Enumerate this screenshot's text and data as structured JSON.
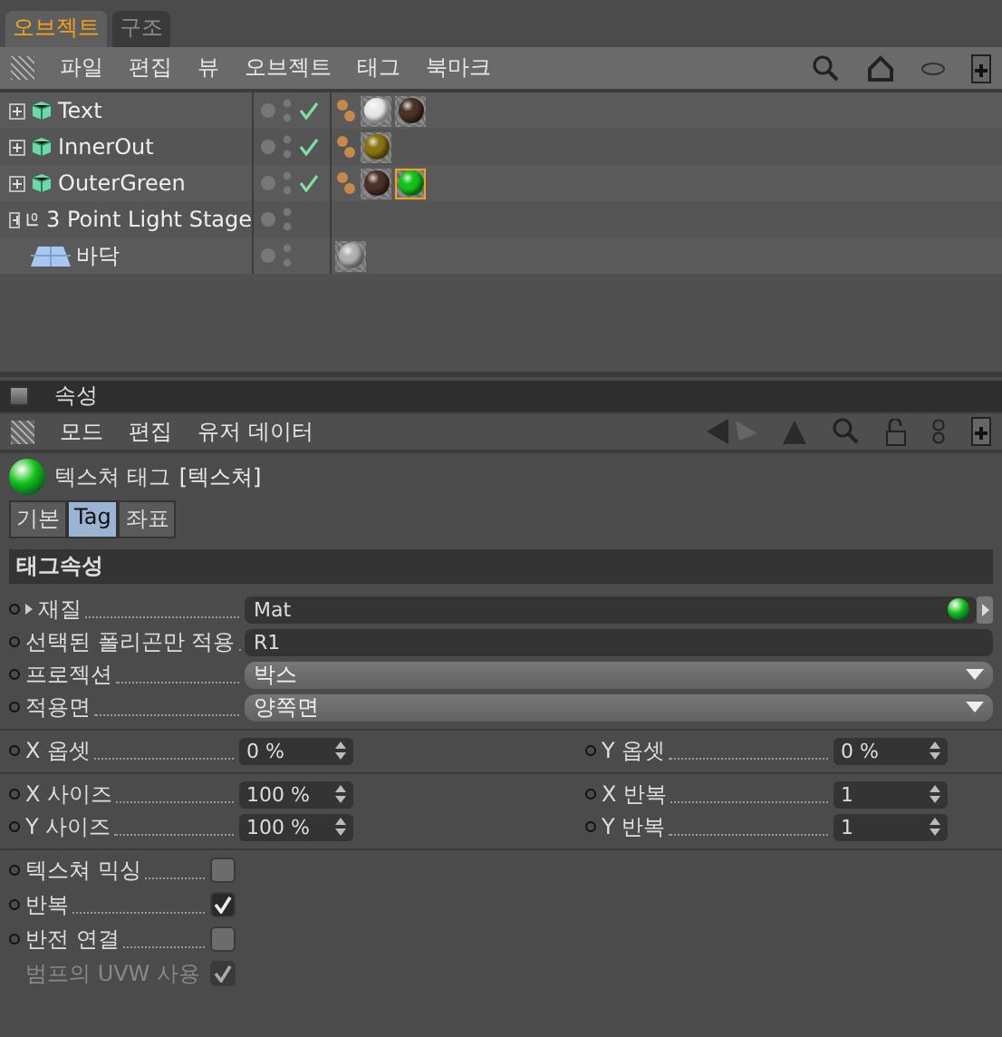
{
  "object_manager": {
    "tabs": [
      {
        "label": "오브젝트",
        "selected": true
      },
      {
        "label": "구조",
        "selected": false
      }
    ],
    "menu": [
      "파일",
      "편집",
      "뷰",
      "오브젝트",
      "태그",
      "북마크"
    ],
    "objects": [
      {
        "name": "Text",
        "kind": "null",
        "expandable": true,
        "checked": true,
        "tags": [
          {
            "kind": "phong"
          },
          {
            "kind": "material",
            "color": "#e8e8e8",
            "selected": false
          },
          {
            "kind": "material",
            "color": "#4a3326",
            "selected": false
          }
        ]
      },
      {
        "name": "InnerOut",
        "kind": "null",
        "expandable": true,
        "checked": true,
        "tags": [
          {
            "kind": "phong"
          },
          {
            "kind": "material",
            "color": "#8a7410",
            "selected": false
          }
        ]
      },
      {
        "name": "OuterGreen",
        "kind": "null",
        "expandable": true,
        "checked": true,
        "tags": [
          {
            "kind": "phong"
          },
          {
            "kind": "material",
            "color": "#4a3326",
            "selected": false
          },
          {
            "kind": "material",
            "color": "#14c21a",
            "selected": true
          }
        ]
      },
      {
        "name": "3 Point Light Stage",
        "kind": "light",
        "expandable": true,
        "checked": false
      },
      {
        "name": "바닥",
        "kind": "floor",
        "expandable": false,
        "checked": false,
        "tags": [
          {
            "kind": "material",
            "color": "#b0b0b0",
            "selected": false
          }
        ]
      }
    ]
  },
  "attributes": {
    "title": "속성",
    "menu": [
      "모드",
      "편집",
      "유저 데이터"
    ],
    "heading": "텍스쳐 태그",
    "heading_suffix": "[텍스쳐]",
    "tabs": [
      {
        "label": "기본",
        "selected": false
      },
      {
        "label": "Tag",
        "selected": true
      },
      {
        "label": "좌표",
        "selected": false
      }
    ],
    "section": "태그속성",
    "groups": [
      {
        "kind": "single",
        "items": [
          {
            "kind": "link",
            "label": "재질",
            "value": "Mat"
          },
          {
            "kind": "text",
            "label": "선택된 폴리곤만 적용",
            "value": "R1"
          },
          {
            "kind": "dropdown",
            "label": "프로젝션",
            "value": "박스"
          },
          {
            "kind": "dropdown",
            "label": "적용면",
            "value": "양쪽면"
          }
        ]
      },
      {
        "kind": "pairs",
        "items": [
          {
            "kind": "number",
            "label": "X 옵셋",
            "value": "0 %"
          },
          {
            "kind": "number",
            "label": "Y 옵셋",
            "value": "0 %"
          }
        ]
      },
      {
        "kind": "pairs",
        "items": [
          {
            "kind": "number",
            "label": "X 사이즈",
            "value": "100 %"
          },
          {
            "kind": "number",
            "label": "X 반복",
            "value": "1"
          },
          {
            "kind": "number",
            "label": "Y 사이즈",
            "value": "100 %"
          },
          {
            "kind": "number",
            "label": "Y 반복",
            "value": "1"
          }
        ]
      },
      {
        "kind": "checks",
        "items": [
          {
            "kind": "checkbox",
            "label": "텍스쳐 믹싱",
            "checked": false,
            "disabled": false
          },
          {
            "kind": "checkbox",
            "label": "반복",
            "checked": true,
            "disabled": false
          },
          {
            "kind": "checkbox",
            "label": "반전 연결",
            "checked": false,
            "disabled": false
          },
          {
            "kind": "checkbox",
            "label": "범프의 UVW 사용",
            "checked": true,
            "disabled": true
          }
        ]
      }
    ]
  }
}
